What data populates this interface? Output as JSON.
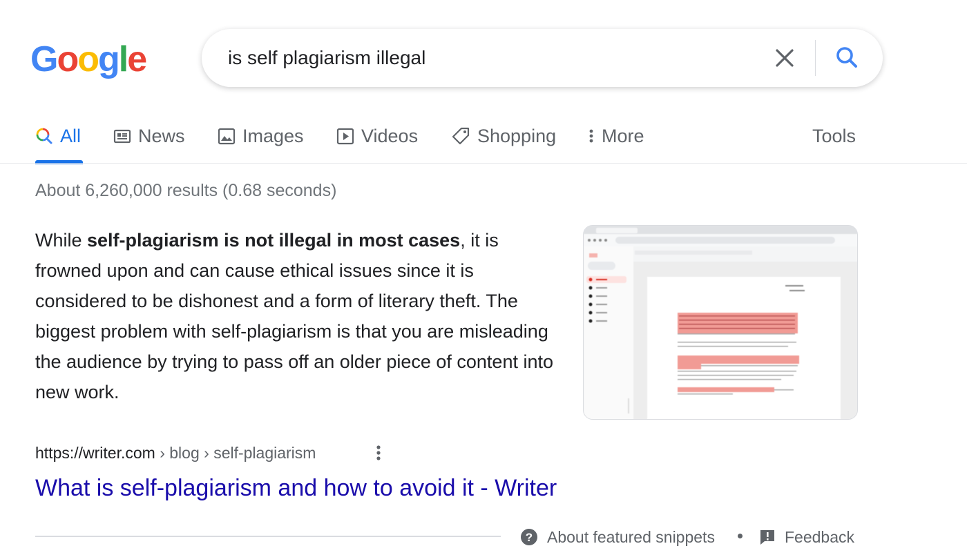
{
  "logo": {
    "letters": [
      "G",
      "o",
      "o",
      "g",
      "l",
      "e"
    ],
    "colors": [
      "#4285F4",
      "#EA4335",
      "#FBBC05",
      "#4285F4",
      "#34A853",
      "#EA4335"
    ]
  },
  "search": {
    "query": "is self plagiarism illegal",
    "clear_icon": "close-icon",
    "search_icon": "search-icon"
  },
  "tabs": [
    {
      "label": "All",
      "icon": "search-multicolor-icon",
      "active": true
    },
    {
      "label": "News",
      "icon": "news-icon"
    },
    {
      "label": "Images",
      "icon": "image-icon"
    },
    {
      "label": "Videos",
      "icon": "play-icon"
    },
    {
      "label": "Shopping",
      "icon": "tag-icon"
    },
    {
      "label": "More",
      "icon": "more-vert-icon"
    }
  ],
  "tools_label": "Tools",
  "result_stats": "About 6,260,000 results (0.68 seconds)",
  "snippet": {
    "pre": "While ",
    "bold": "self-plagiarism is not illegal in most cases",
    "post": ", it is frowned upon and can cause ethical issues since it is considered to be dishonest and a form of literary theft. The biggest problem with self-plagiarism is that you are misleading the audience by trying to pass off an older piece of content into new work."
  },
  "result": {
    "site": "https://writer.com",
    "path": " › blog › self-plagiarism",
    "title": "What is self-plagiarism and how to avoid it - Writer"
  },
  "footer": {
    "about": "About featured snippets",
    "feedback": "Feedback"
  },
  "colors": {
    "accent": "#1a73e8",
    "link": "#1a0dab",
    "text": "#202124",
    "muted": "#5f6368"
  }
}
